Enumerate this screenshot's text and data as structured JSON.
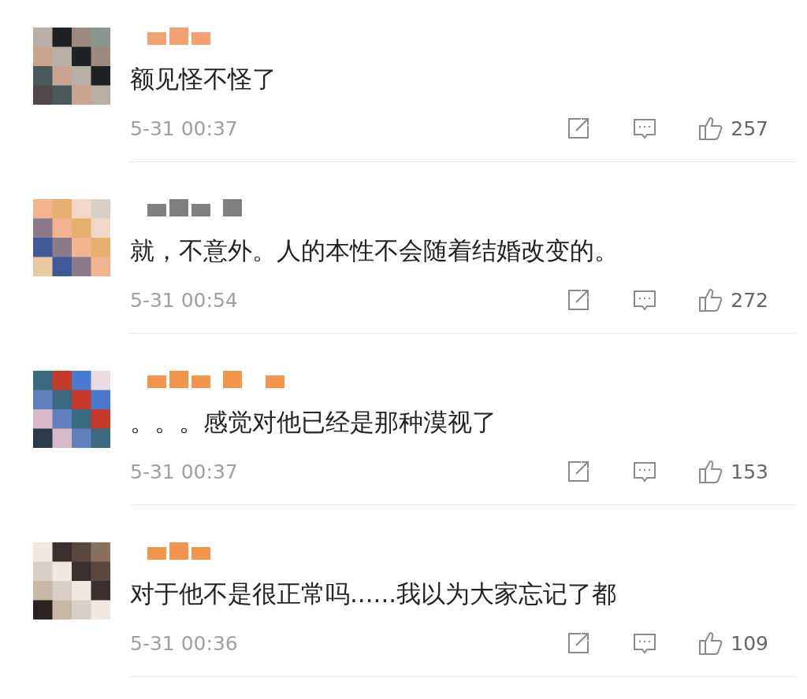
{
  "comments": [
    {
      "text": "额见怪不怪了",
      "time": "5-31 00:37",
      "likes": "257"
    },
    {
      "text": "就，不意外。人的本性不会随着结婚改变的。",
      "time": "5-31 00:54",
      "likes": "272"
    },
    {
      "text": "。。。感觉对他已经是那种漠视了",
      "time": "5-31 00:37",
      "likes": "153"
    },
    {
      "text": "对于他不是很正常吗......我以为大家忘记了都",
      "time": "5-31 00:36",
      "likes": "109"
    }
  ]
}
